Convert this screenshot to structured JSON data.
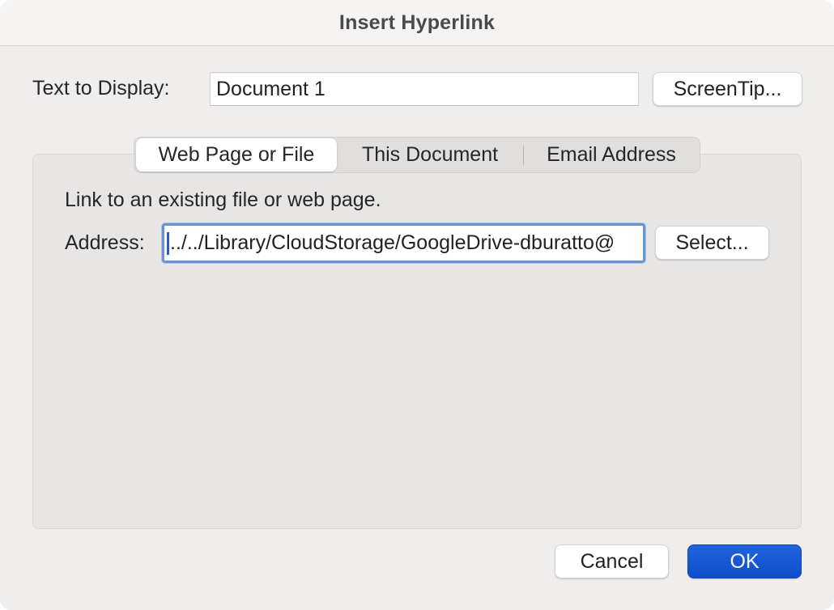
{
  "dialog": {
    "title": "Insert Hyperlink"
  },
  "text_to_display": {
    "label": "Text to Display:",
    "value": "Document 1"
  },
  "buttons": {
    "screentip": "ScreenTip...",
    "select": "Select...",
    "cancel": "Cancel",
    "ok": "OK"
  },
  "tabs": [
    {
      "label": "Web Page or File",
      "active": true
    },
    {
      "label": "This Document",
      "active": false
    },
    {
      "label": "Email Address",
      "active": false
    }
  ],
  "panel": {
    "description": "Link to an existing file or web page.",
    "address_label": "Address:",
    "address_value": "../../Library/CloudStorage/GoogleDrive-dburatto@"
  },
  "colors": {
    "primary_button": "#1f63e0",
    "focus_ring": "#6d93cf"
  }
}
